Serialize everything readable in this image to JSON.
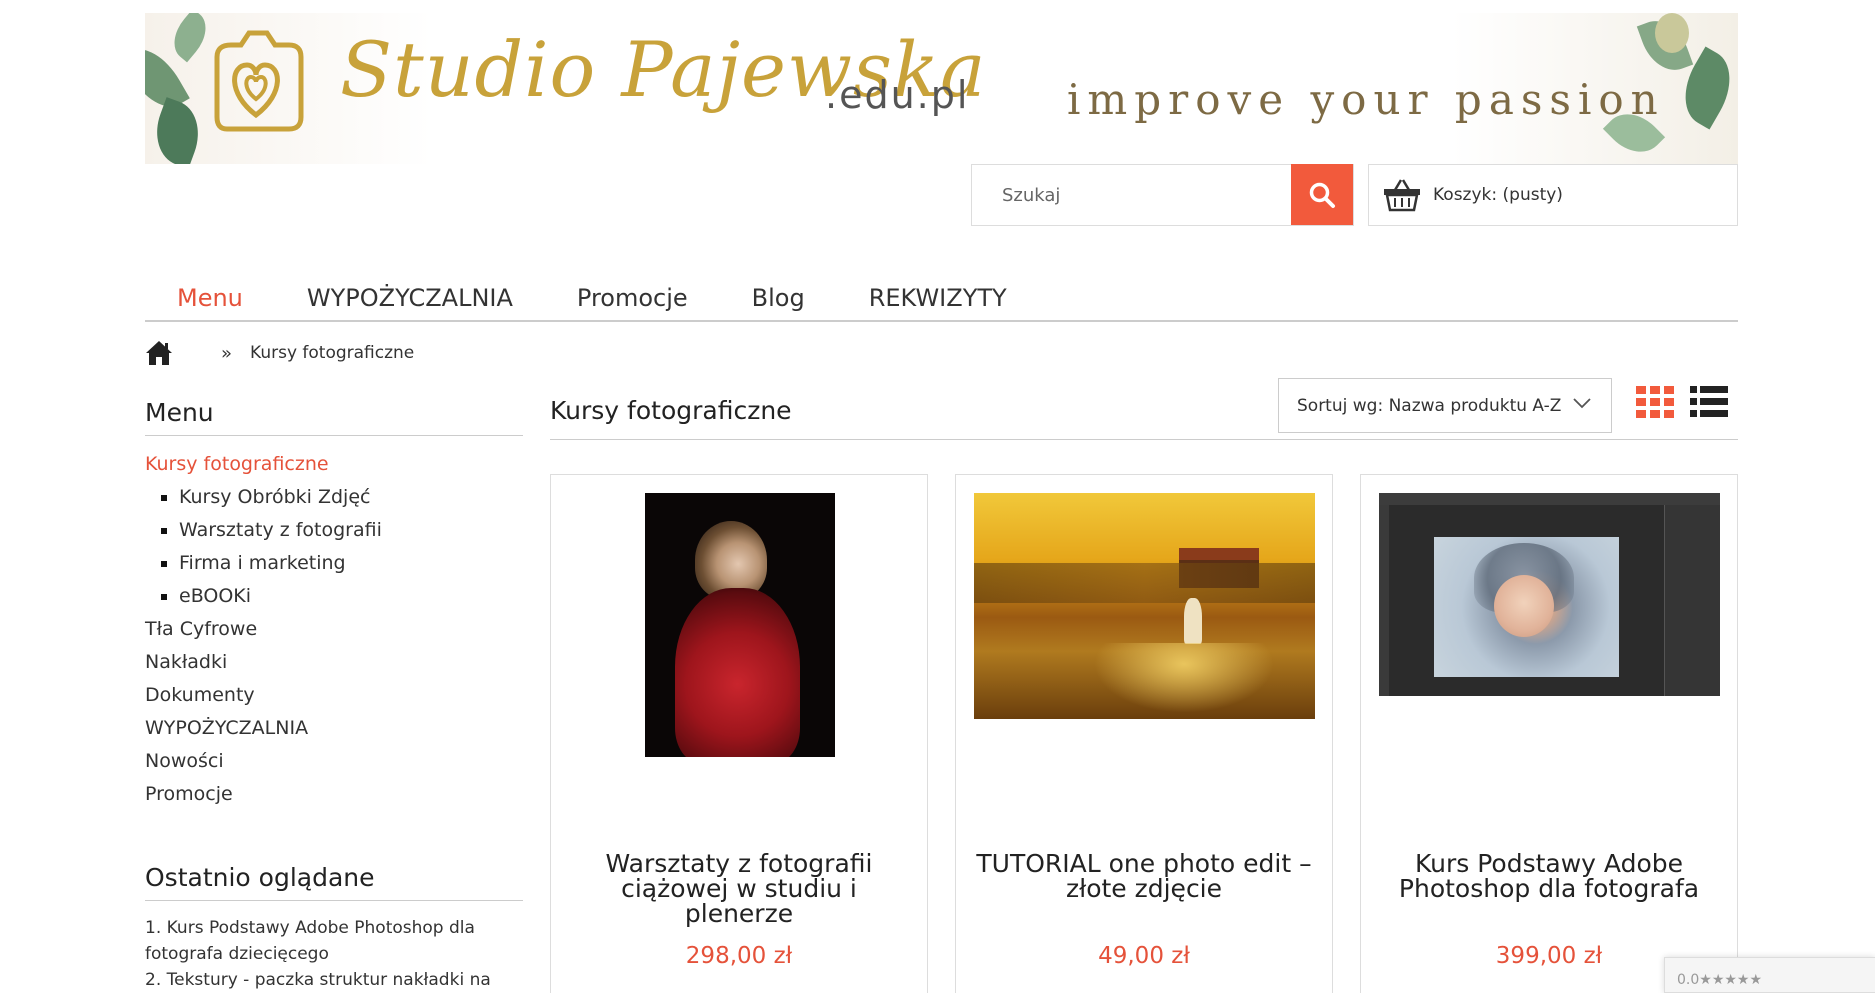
{
  "header": {
    "logo_text": "Studio Pajewska",
    "logo_domain": ".edu.pl",
    "tagline": "improve your passion"
  },
  "search": {
    "placeholder": "Szukaj"
  },
  "cart": {
    "label": "Koszyk: (pusty)"
  },
  "topnav": {
    "items": [
      {
        "label": "Menu"
      },
      {
        "label": "WYPOŻYCZALNIA"
      },
      {
        "label": "Promocje"
      },
      {
        "label": "Blog"
      },
      {
        "label": "REKWIZYTY"
      }
    ]
  },
  "breadcrumb": {
    "separator": "»",
    "current": "Kursy fotograficzne"
  },
  "sidebar": {
    "title": "Menu",
    "items": [
      {
        "label": "Kursy fotograficzne"
      },
      {
        "label": "Kursy Obróbki Zdjęć"
      },
      {
        "label": "Warsztaty z fotografii"
      },
      {
        "label": "Firma i marketing"
      },
      {
        "label": "eBOOKi"
      },
      {
        "label": "Tła Cyfrowe"
      },
      {
        "label": "Nakładki"
      },
      {
        "label": "Dokumenty"
      },
      {
        "label": "WYPOŻYCZALNIA"
      },
      {
        "label": "Nowości"
      },
      {
        "label": "Promocje"
      }
    ],
    "recent_title": "Ostatnio oglądane",
    "recent_items": [
      {
        "label": "1. Kurs Podstawy Adobe Photoshop dla fotografa dziecięcego"
      },
      {
        "label": "2. Tekstury - paczka struktur nakładki na"
      }
    ]
  },
  "main": {
    "title": "Kursy fotograficzne",
    "sort_label": "Sortuj wg: Nazwa produktu A-Z",
    "products": [
      {
        "name": "Warsztaty z fotografii ciążowej w studiu i plenerze",
        "price": "298,00 zł"
      },
      {
        "name": "TUTORIAL one photo edit – złote zdjęcie",
        "price": "49,00 zł"
      },
      {
        "name": "Kurs Podstawy Adobe Photoshop dla fotografa",
        "price": "399,00 zł"
      }
    ]
  },
  "rating_widget": {
    "text": "0.0★★★★★"
  },
  "colors": {
    "accent": "#e5523a",
    "search_button": "#f25a3c",
    "gold": "#c8a23a"
  }
}
